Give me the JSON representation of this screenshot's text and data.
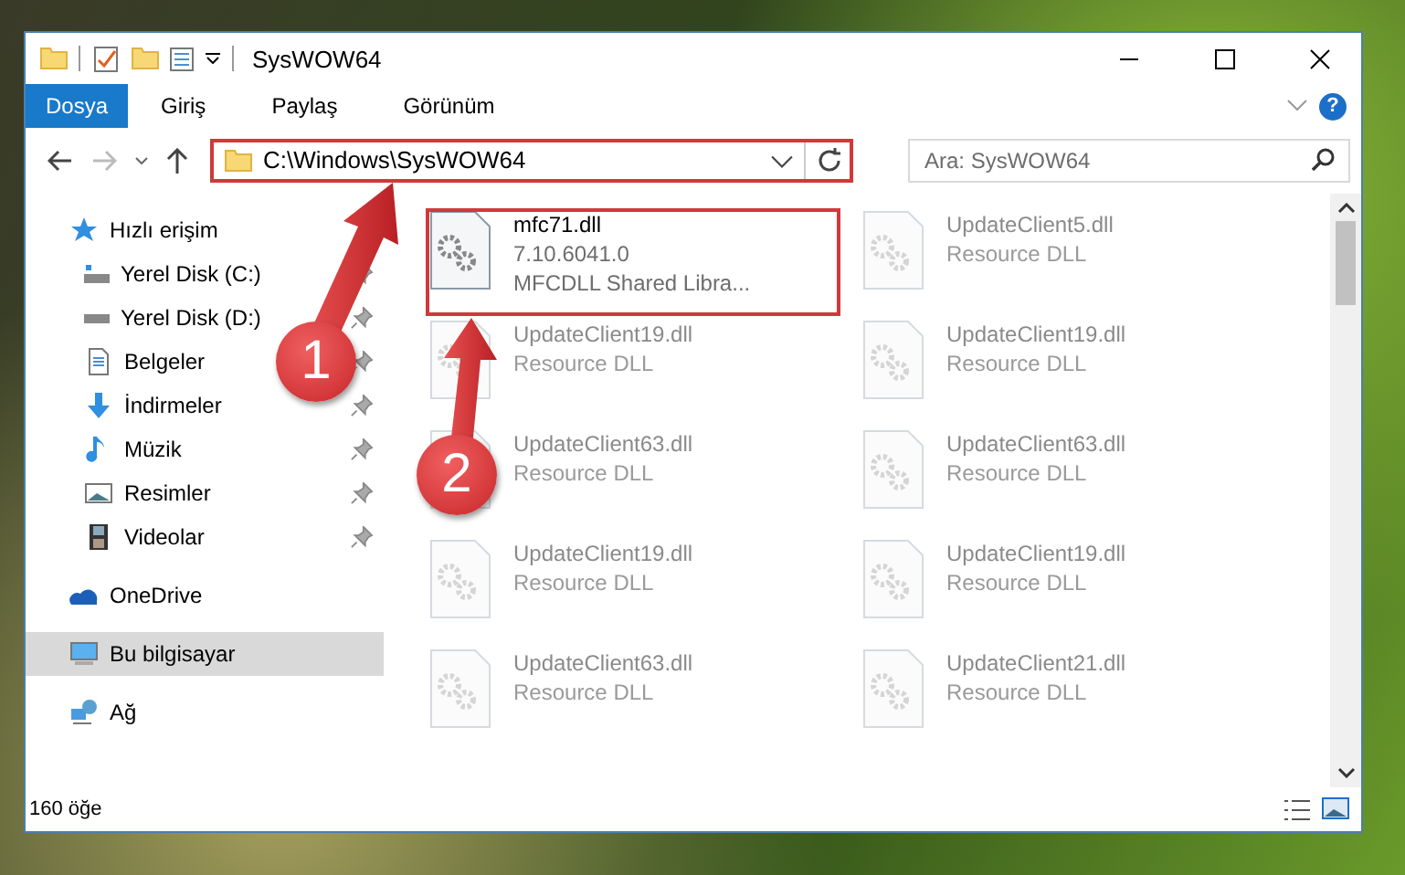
{
  "window": {
    "title": "SysWOW64"
  },
  "ribbon": {
    "tabs": [
      {
        "label": "Dosya",
        "selected": true
      },
      {
        "label": "Giriş",
        "selected": false
      },
      {
        "label": "Paylaş",
        "selected": false
      },
      {
        "label": "Görünüm",
        "selected": false
      }
    ],
    "help_label": "?"
  },
  "address_bar": {
    "path": "C:\\Windows\\SysWOW64"
  },
  "search": {
    "placeholder": "Ara: SysWOW64"
  },
  "sidebar": {
    "items": [
      {
        "label": "Hızlı erişim",
        "selected": false,
        "children": [
          {
            "label": "Yerel Disk (C:)",
            "pinned": true
          },
          {
            "label": "Yerel Disk (D:)",
            "pinned": true
          },
          {
            "label": "Belgeler",
            "pinned": true
          },
          {
            "label": "İndirmeler",
            "pinned": true
          },
          {
            "label": "Müzik",
            "pinned": true
          },
          {
            "label": "Resimler",
            "pinned": true
          },
          {
            "label": "Videolar",
            "pinned": true
          }
        ]
      },
      {
        "label": "OneDrive",
        "selected": false
      },
      {
        "label": "Bu bilgisayar",
        "selected": true
      },
      {
        "label": "Ağ",
        "selected": false
      }
    ]
  },
  "files": [
    {
      "name": "mfc71.dll",
      "version": "7.10.6041.0",
      "description": "MFCDLL Shared Libra...",
      "faded": false
    },
    {
      "name": "UpdateClient5.dll",
      "description": "Resource DLL",
      "faded": true
    },
    {
      "name": "UpdateClient19.dll",
      "description": "Resource DLL",
      "faded": true
    },
    {
      "name": "UpdateClient19.dll",
      "description": "Resource DLL",
      "faded": true
    },
    {
      "name": "UpdateClient63.dll",
      "description": "Resource DLL",
      "faded": true
    },
    {
      "name": "UpdateClient63.dll",
      "description": "Resource DLL",
      "faded": true
    },
    {
      "name": "UpdateClient19.dll",
      "description": "Resource DLL",
      "faded": true
    },
    {
      "name": "UpdateClient19.dll",
      "description": "Resource DLL",
      "faded": true
    },
    {
      "name": "UpdateClient63.dll",
      "description": "Resource DLL",
      "faded": true
    },
    {
      "name": "UpdateClient21.dll",
      "description": "Resource DLL",
      "faded": true
    }
  ],
  "status_bar": {
    "item_count": "160 öğe"
  },
  "annotations": [
    {
      "label": "1"
    },
    {
      "label": "2"
    }
  ]
}
